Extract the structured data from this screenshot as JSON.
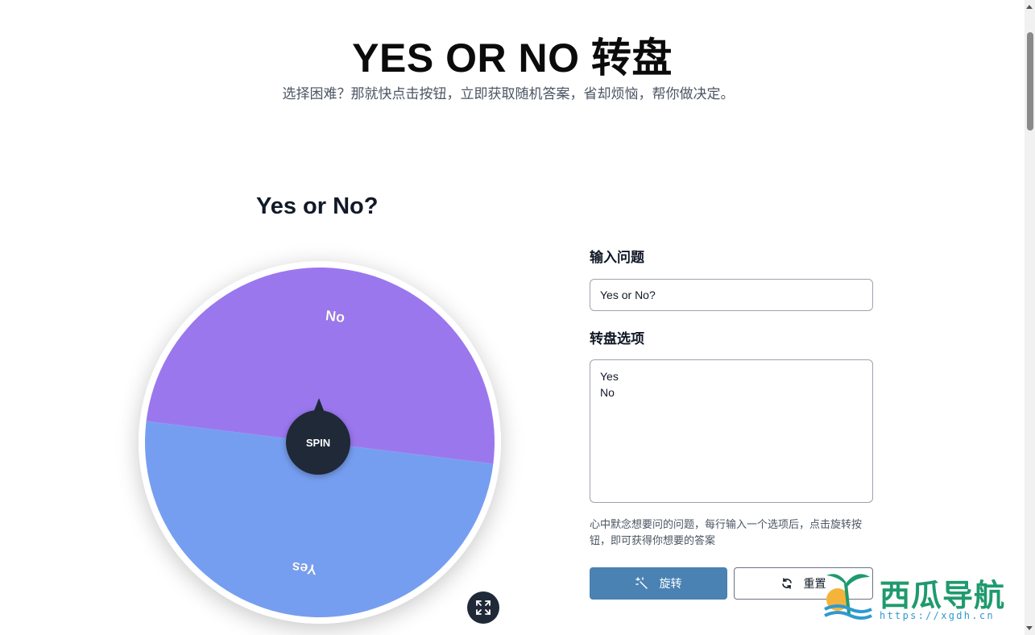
{
  "header": {
    "title": "YES OR NO 转盘",
    "subtitle": "选择困难？那就快点击按钮，立即获取随机答案，省却烦恼，帮你做决定。"
  },
  "wheel": {
    "title": "Yes or No?",
    "spin_label": "SPIN",
    "segments": [
      {
        "label": "Yes",
        "color": "#769ef0"
      },
      {
        "label": "No",
        "color": "#9b77ee"
      }
    ],
    "fullscreen_icon": "expand-icon"
  },
  "form": {
    "question_label": "输入问题",
    "question_value": "Yes or No?",
    "options_label": "转盘选项",
    "options_value": "Yes\nNo",
    "help_text": "心中默念想要问的问题，每行输入一个选项后，点击旋转按钮，即可获得你想要的答案",
    "rotate_label": "旋转",
    "reset_label": "重置",
    "rotate_color": "#4a82b3"
  },
  "watermark": {
    "brand": "西瓜导航",
    "url": "https://xgdh.cn"
  }
}
